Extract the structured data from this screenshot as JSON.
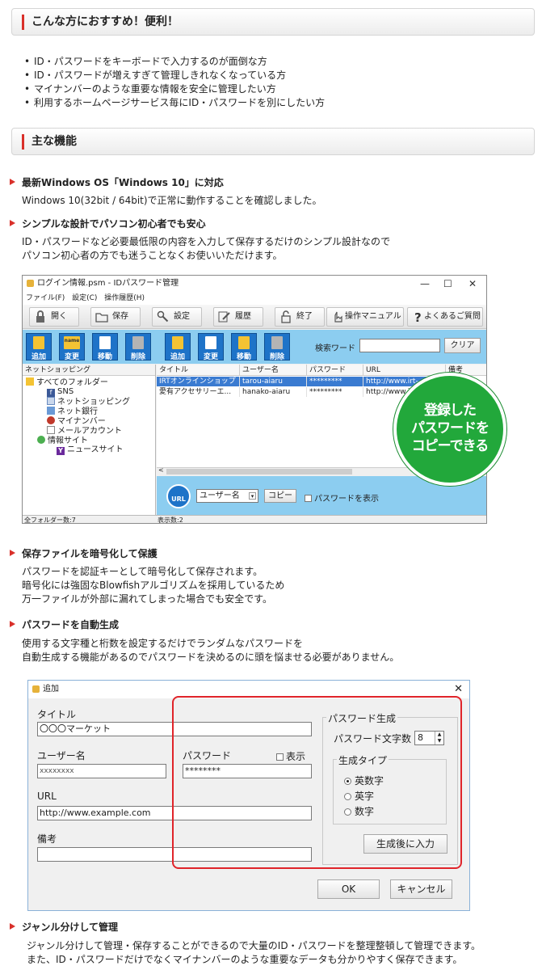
{
  "section1": {
    "title": "こんな方におすすめ！便利！"
  },
  "recommend": [
    "ID・パスワードをキーボードで入力するのが面倒な方",
    "ID・パスワードが増えすぎて管理しきれなくなっている方",
    "マイナンバーのような重要な情報を安全に管理したい方",
    "利用するホームページサービス毎にID・パスワードを別にしたい方"
  ],
  "section2": {
    "title": "主な機能"
  },
  "features": [
    {
      "title": "最新Windows OS「Windows 10」に対応",
      "lines": [
        "Windows 10(32bit / 64bit)で正常に動作することを確認しました。"
      ]
    },
    {
      "title": "シンプルな設計でパソコン初心者でも安心",
      "lines": [
        "ID・パスワードなど必要最低限の内容を入力して保存するだけのシンプル設計なので",
        "パソコン初心者の方でも迷うことなくお使いいただけます。"
      ]
    },
    {
      "title": "保存ファイルを暗号化して保護",
      "lines": [
        "パスワードを認証キーとして暗号化して保存されます。",
        "暗号化には強固なBlowfishアルゴリズムを採用しているため",
        "万一ファイルが外部に漏れてしまった場合でも安全です。"
      ]
    },
    {
      "title": "パスワードを自動生成",
      "lines": [
        "使用する文字種と桁数を設定するだけでランダムなパスワードを",
        "自動生成する機能があるのでパスワードを決めるのに頭を悩ませる必要がありません。"
      ]
    },
    {
      "title": "ジャンル分けして管理",
      "lines": [
        "ジャンル分けして管理・保存することができるので大量のID・パスワードを整理整頓して管理できます。",
        "また、ID・パスワードだけでなくマイナンバーのような重要なデータも分かりやすく保存できます。"
      ]
    }
  ],
  "app": {
    "title": "ログイン情報.psm - IDパスワード管理",
    "controls": {
      "min": "—",
      "max": "☐",
      "close": "✕"
    },
    "menu": [
      "ファイル(F)",
      "設定(C)",
      "操作履歴(H)"
    ],
    "toolbar": [
      "開く",
      "保存",
      "設定",
      "履歴",
      "終了",
      "操作マニュアル",
      "よくあるご質問"
    ],
    "ops_left": [
      "追加",
      "変更",
      "移動",
      "削除"
    ],
    "ops_right": [
      "追加",
      "変更",
      "移動",
      "削除"
    ],
    "icon_name_label": "name",
    "search_label": "検索ワード",
    "search_value": "",
    "clear_label": "クリア",
    "tree_header": "ネットショッピング",
    "tree": [
      "すべてのフォルダー",
      "SNS",
      "ネットショッピング",
      "ネット銀行",
      "マイナンバー",
      "メールアカウント",
      "情報サイト",
      "ニュースサイト"
    ],
    "tree_icon_letters": {
      "sns": "f",
      "news": "Y"
    },
    "columns": [
      "タイトル",
      "ユーザー名",
      "パスワード",
      "URL",
      "備考"
    ],
    "rows": [
      [
        "IRTオンラインショップ",
        "tarou-aiaru",
        "*********",
        "http://www.irt-"
      ],
      [
        "愛有アクセサリーエ...",
        "hanako-aiaru",
        "*********",
        "http://www.ir"
      ]
    ],
    "url_icon_label": "URL",
    "user_select": "ユーザー名",
    "select_arrow": "▾",
    "copy_label": "コピー",
    "show_pw_label": "パスワードを表示",
    "scroll_left": "<",
    "status_left": "全フォルダー数:7",
    "status_right": "表示数:2",
    "badge": [
      "登録した",
      "パスワードを",
      "コピーできる"
    ]
  },
  "dialog": {
    "title": "追加",
    "close": "✕",
    "title_label": "タイトル",
    "title_value": "〇〇〇マーケット",
    "user_label": "ユーザー名",
    "user_value": "xxxxxxxx",
    "password_label": "パスワード",
    "show_label": "表示",
    "password_value": "********",
    "url_label": "URL",
    "url_value": "http://www.example.com",
    "note_label": "備考",
    "note_value": "",
    "gen_group": "パスワード生成",
    "length_label": "パスワード文字数",
    "length_value": "8",
    "spin_up": "▲",
    "spin_down": "▼",
    "type_group": "生成タイプ",
    "types": [
      "英数字",
      "英字",
      "数字"
    ],
    "selected_type": "英数字",
    "gen_button": "生成後に入力",
    "ok": "OK",
    "cancel": "キャンセル"
  }
}
